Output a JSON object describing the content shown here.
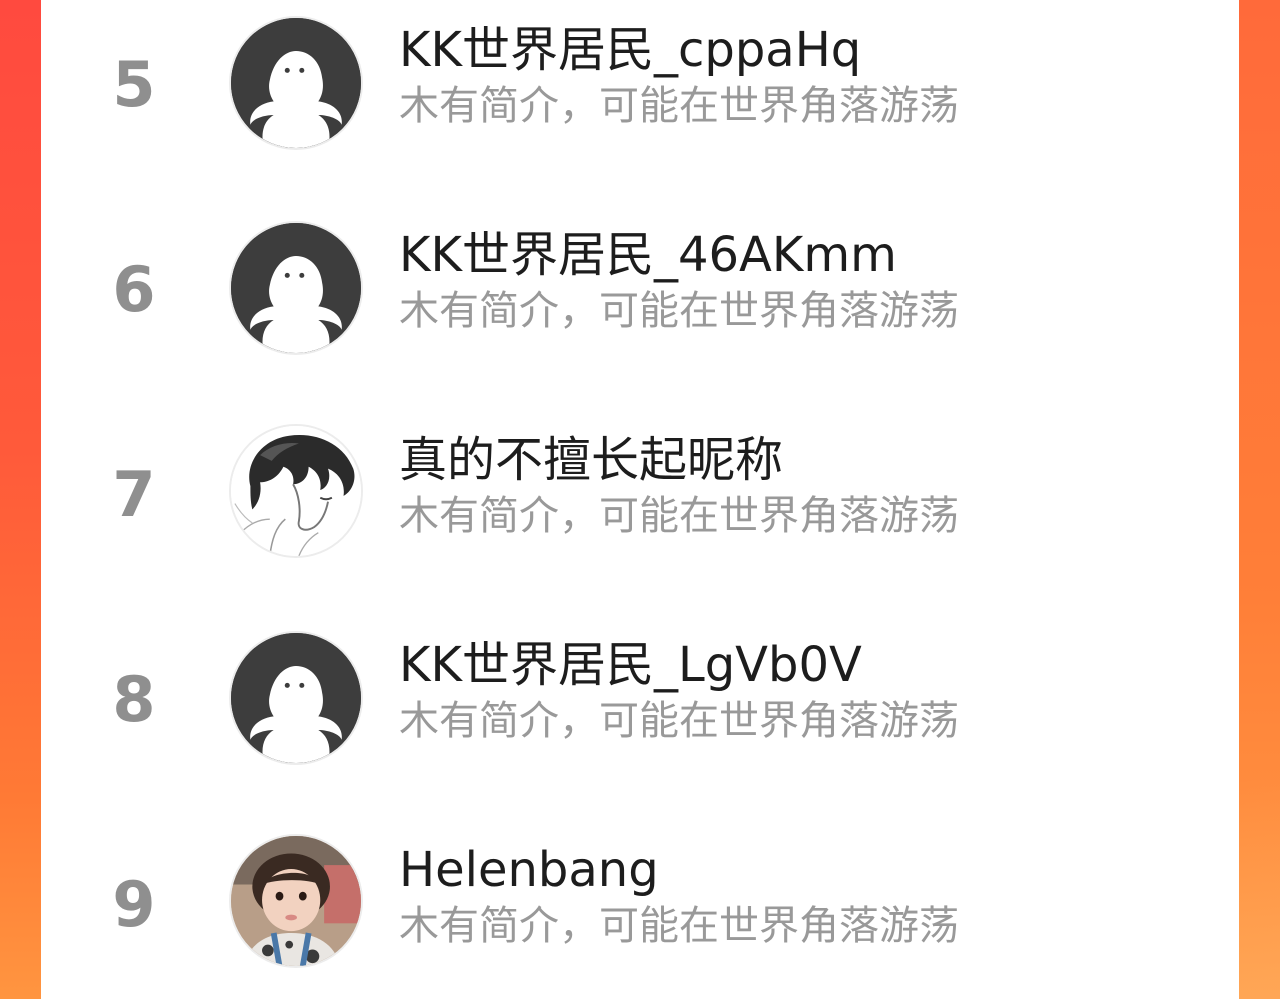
{
  "colors": {
    "accent_left": "#ff4a3f",
    "accent_right": "#ff8a3c",
    "panel_bg": "#ffffff",
    "rank_color": "#8f8f8f",
    "name_color": "#1d1d1d",
    "bio_color": "#999999"
  },
  "ranking": {
    "rows": [
      {
        "rank": "5",
        "name": "KK世界居民_cppaHq",
        "bio": "木有简介，可能在世界角落游荡",
        "avatar": "default-avatar-icon"
      },
      {
        "rank": "6",
        "name": "KK世界居民_46AKmm",
        "bio": "木有简介，可能在世界角落游荡",
        "avatar": "default-avatar-icon"
      },
      {
        "rank": "7",
        "name": "真的不擅长起昵称",
        "bio": "木有简介，可能在世界角落游荡",
        "avatar": "anime-sketch-avatar"
      },
      {
        "rank": "8",
        "name": "KK世界居民_LgVb0V",
        "bio": "木有简介，可能在世界角落游荡",
        "avatar": "default-avatar-icon"
      },
      {
        "rank": "9",
        "name": "Helenbang",
        "bio": "木有简介，可能在世界角落游荡",
        "avatar": "child-photo-avatar"
      }
    ]
  }
}
